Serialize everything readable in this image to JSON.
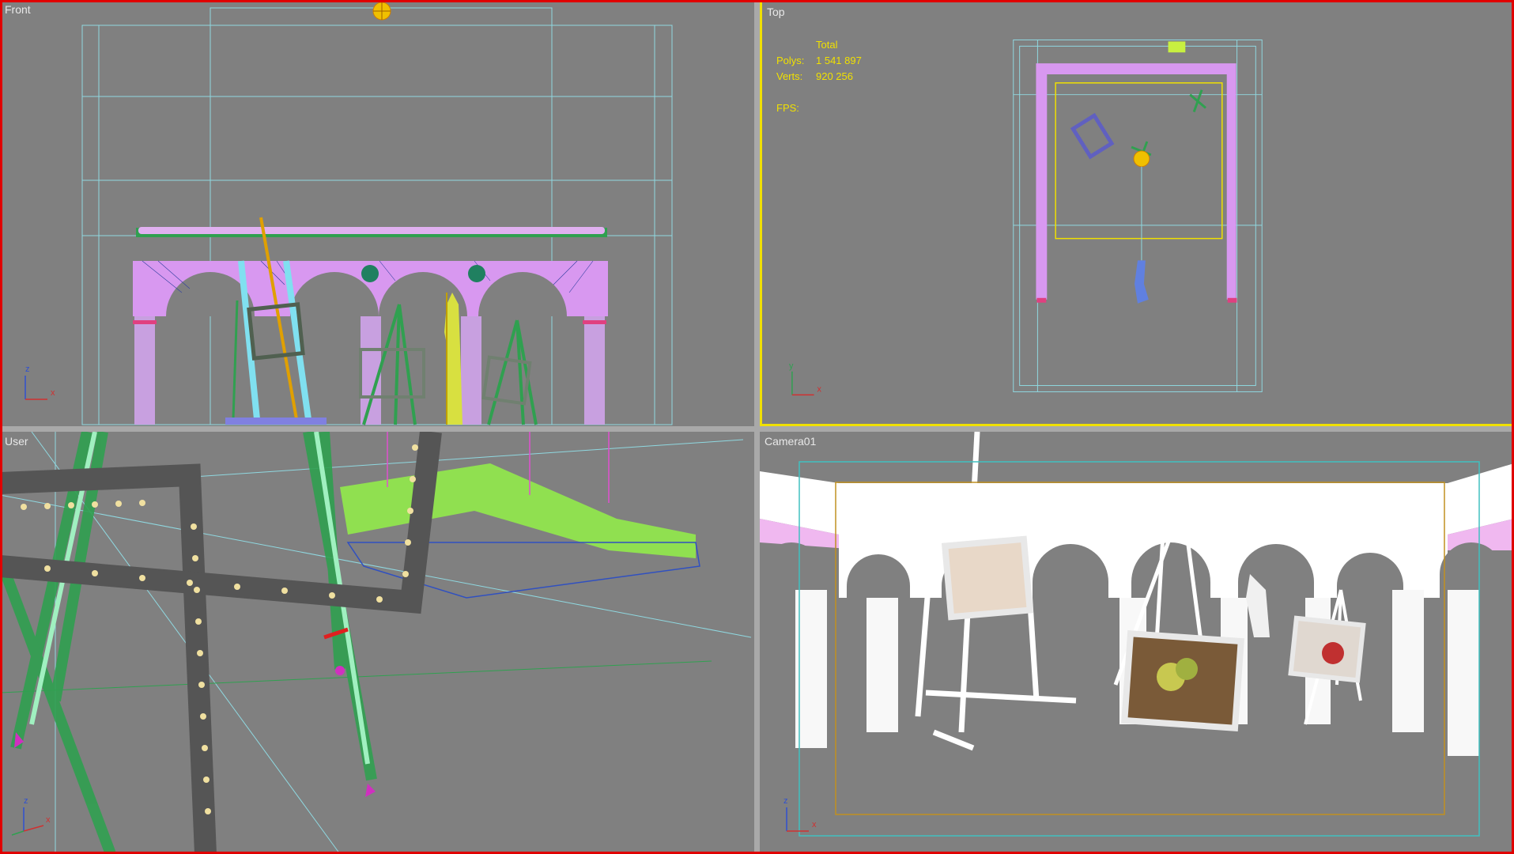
{
  "viewports": {
    "front": {
      "label": "Front"
    },
    "top": {
      "label": "Top"
    },
    "user": {
      "label": "User"
    },
    "camera": {
      "label": "Camera01"
    }
  },
  "stats": {
    "total_label": "Total",
    "polys_label": "Polys:",
    "polys_value": "1 541 897",
    "verts_label": "Verts:",
    "verts_value": "920 256",
    "fps_label": "FPS:"
  },
  "axis": {
    "x": "x",
    "y": "y",
    "z": "z"
  },
  "colors": {
    "viewport_bg": "#808080",
    "active_border": "#f0e000",
    "frame_border": "#e00000",
    "grid": "#8fd8e0",
    "arch": "#d898f0",
    "easel": "#30a050",
    "stats_text": "#f0e000"
  }
}
